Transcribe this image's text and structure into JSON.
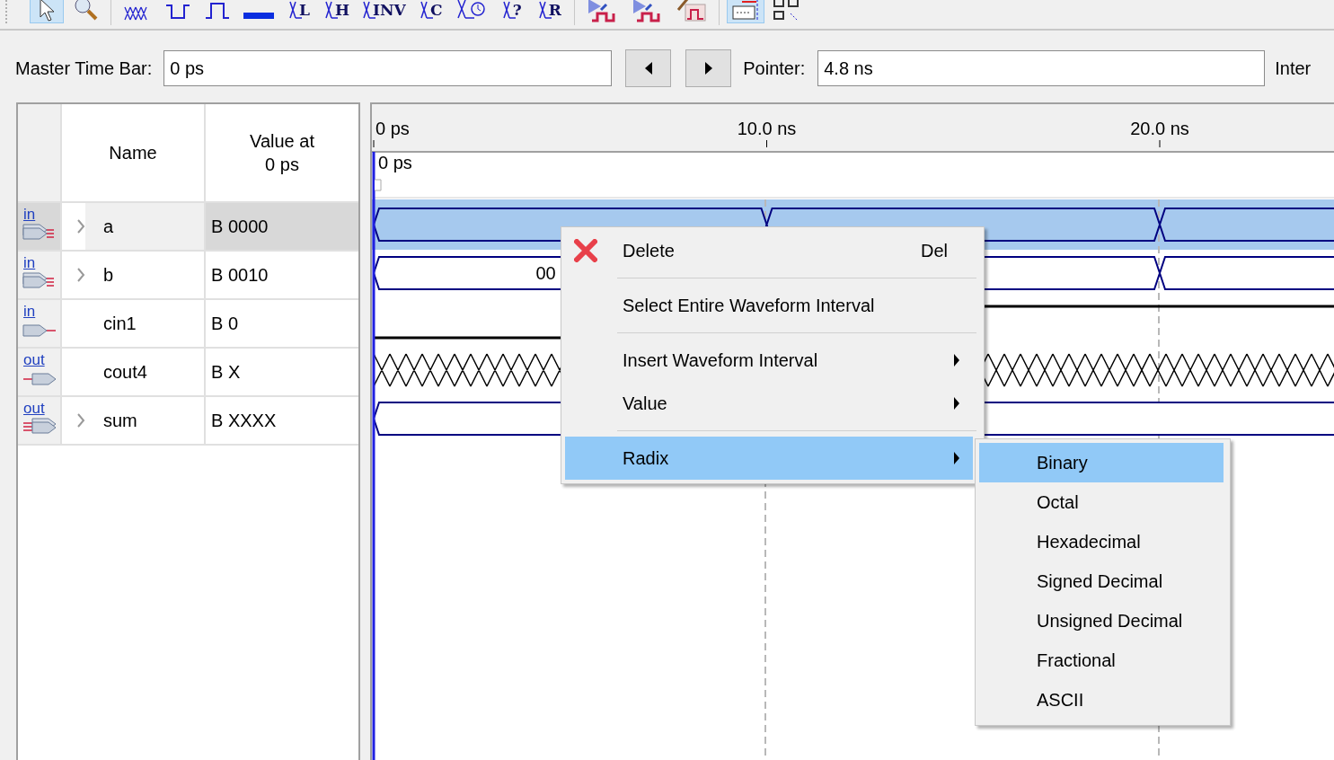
{
  "toolbar": {
    "buttons": [
      {
        "kind": "pointer",
        "selected": true
      },
      {
        "kind": "zoom",
        "selected": false
      },
      {
        "kind": "unknown",
        "selected": false
      },
      {
        "kind": "low",
        "selected": false
      },
      {
        "kind": "high",
        "selected": false
      },
      {
        "kind": "highz",
        "selected": false
      },
      {
        "kind": "glyph",
        "glyph": "L",
        "selected": false
      },
      {
        "kind": "glyph",
        "glyph": "H",
        "selected": false
      },
      {
        "kind": "glyph",
        "glyph": "INV",
        "selected": false
      },
      {
        "kind": "glyph",
        "glyph": "C",
        "selected": false
      },
      {
        "kind": "clock",
        "selected": false
      },
      {
        "kind": "glyph",
        "glyph": "?",
        "selected": false
      },
      {
        "kind": "glyph",
        "glyph": "R",
        "selected": false
      },
      {
        "kind": "simulate",
        "selected": false
      },
      {
        "kind": "simulate",
        "selected": false
      },
      {
        "kind": "edit",
        "selected": false
      },
      {
        "kind": "snap",
        "selected": true
      },
      {
        "kind": "grid",
        "selected": false
      }
    ]
  },
  "time_bar": {
    "master_label": "Master Time Bar:",
    "master_value": "0 ps",
    "pointer_label": "Pointer:",
    "pointer_value": "4.8 ns",
    "interval_label": "Inter"
  },
  "signals": {
    "columns": [
      {
        "lines": [
          "Name"
        ]
      },
      {
        "lines": [
          "Value at",
          "0 ps"
        ]
      }
    ],
    "rows": [
      {
        "direction": "in",
        "kind": "bus",
        "expandable": true,
        "name": "a",
        "value": "B 0000",
        "selected": true,
        "segments": [
          {
            "kind": "bus"
          },
          {
            "kind": "bus"
          },
          {
            "kind": "bus"
          }
        ]
      },
      {
        "direction": "in",
        "kind": "bus",
        "expandable": true,
        "name": "b",
        "value": "B 0010",
        "selected": false,
        "segments": [
          {
            "kind": "bus",
            "label": "00"
          },
          {
            "kind": "bus"
          },
          {
            "kind": "bus"
          }
        ]
      },
      {
        "direction": "in",
        "kind": "single",
        "expandable": false,
        "name": "cin1",
        "value": "B 0",
        "selected": false,
        "segments": [
          {
            "kind": "low"
          },
          {
            "kind": "high"
          }
        ]
      },
      {
        "direction": "out",
        "kind": "single",
        "expandable": false,
        "name": "cout4",
        "value": "B X",
        "selected": false,
        "segments": [
          {
            "kind": "unknown"
          }
        ]
      },
      {
        "direction": "out",
        "kind": "bus",
        "expandable": true,
        "name": "sum",
        "value": "B XXXX",
        "selected": false,
        "segments": [
          {
            "kind": "bus"
          }
        ]
      }
    ]
  },
  "waveform": {
    "ticks": [
      "0 ps",
      "10.0 ns",
      "20.0 ns"
    ],
    "cursor_label": "0 ps"
  },
  "context_menu": {
    "items": [
      {
        "kind": "delete",
        "label": "Delete",
        "shortcut": "Del",
        "selected": false
      },
      {
        "kind": "separator"
      },
      {
        "kind": "command",
        "label": "Select Entire Waveform Interval",
        "selected": false
      },
      {
        "kind": "separator"
      },
      {
        "kind": "submenu",
        "label": "Insert Waveform Interval",
        "selected": false
      },
      {
        "kind": "submenu",
        "label": "Value",
        "selected": false
      },
      {
        "kind": "separator"
      },
      {
        "kind": "submenu",
        "label": "Radix",
        "selected": true
      }
    ],
    "submenu": [
      {
        "label": "Binary",
        "selected": true
      },
      {
        "label": "Octal",
        "selected": false
      },
      {
        "label": "Hexadecimal",
        "selected": false
      },
      {
        "label": "Signed Decimal",
        "selected": false
      },
      {
        "label": "Unsigned Decimal",
        "selected": false
      },
      {
        "label": "Fractional",
        "selected": false
      },
      {
        "label": "ASCII",
        "selected": false
      }
    ]
  }
}
